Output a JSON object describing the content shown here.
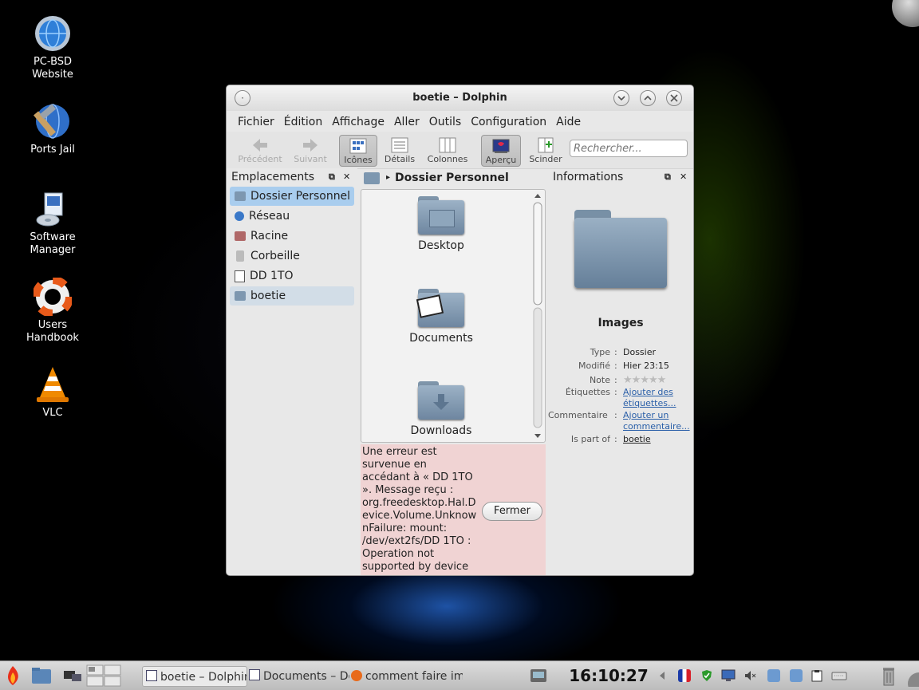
{
  "desktop": {
    "icons": [
      {
        "label_line1": "PC-BSD",
        "label_line2": "Website",
        "icon": "globe-gear-icon"
      },
      {
        "label_line1": "Ports Jail",
        "label_line2": "",
        "icon": "globe-hammer-icon"
      },
      {
        "label_line1": "Software",
        "label_line2": "Manager",
        "icon": "software-package-icon"
      },
      {
        "label_line1": "Users",
        "label_line2": "Handbook",
        "icon": "lifebuoy-icon"
      },
      {
        "label_line1": "VLC",
        "label_line2": "",
        "icon": "vlc-cone-icon"
      }
    ]
  },
  "window": {
    "title": "boetie – Dolphin",
    "menu": [
      "Fichier",
      "Édition",
      "Affichage",
      "Aller",
      "Outils",
      "Configuration",
      "Aide"
    ],
    "toolbar": {
      "back": "Précédent",
      "forward": "Suivant",
      "icons": "Icônes",
      "details": "Détails",
      "columns": "Colonnes",
      "preview": "Aperçu",
      "split": "Scinder",
      "search_placeholder": "Rechercher..."
    },
    "places": {
      "title": "Emplacements",
      "items": [
        {
          "label": "Dossier Personnel",
          "state": "selected"
        },
        {
          "label": "Réseau",
          "state": ""
        },
        {
          "label": "Racine",
          "state": ""
        },
        {
          "label": "Corbeille",
          "state": ""
        },
        {
          "label": "DD 1TO",
          "state": ""
        },
        {
          "label": "boetie",
          "state": "hover"
        }
      ]
    },
    "breadcrumb": "Dossier Personnel",
    "files": [
      {
        "name": "Desktop",
        "icon": "desktop-folder-icon"
      },
      {
        "name": "Documents",
        "icon": "documents-folder-icon"
      },
      {
        "name": "Downloads",
        "icon": "downloads-folder-icon"
      }
    ],
    "error": {
      "message": "Une erreur est survenue en accédant à «  DD 1TO  ». Message reçu  : org.freedesktop.Hal.Device.Volume.UnknownFailure: mount: /dev/ext2fs/DD 1TO : Operation not supported by device",
      "close_button": "Fermer"
    },
    "info": {
      "title": "Informations",
      "item_name": "Images",
      "rows": {
        "type_key": "Type",
        "type_val": "Dossier",
        "modified_key": "Modifié",
        "modified_val": "Hier 23:15",
        "rating_key": "Note",
        "tags_key": "Étiquettes",
        "tags_val": "Ajouter des étiquettes...",
        "comment_key": "Commentaire",
        "comment_val": "Ajouter un commentaire...",
        "partof_key": "Is part of",
        "partof_val": "boetie"
      },
      "rating_stars": 0
    }
  },
  "taskbar": {
    "tasks": [
      "boetie – Dolphin",
      "Documents – Dolphin",
      "comment faire imprimer"
    ],
    "clock": "16:10:27"
  },
  "colors": {
    "selection": "#a9cdee",
    "error_bg": "#f0d3d3",
    "folder": "#8aa2b8"
  }
}
